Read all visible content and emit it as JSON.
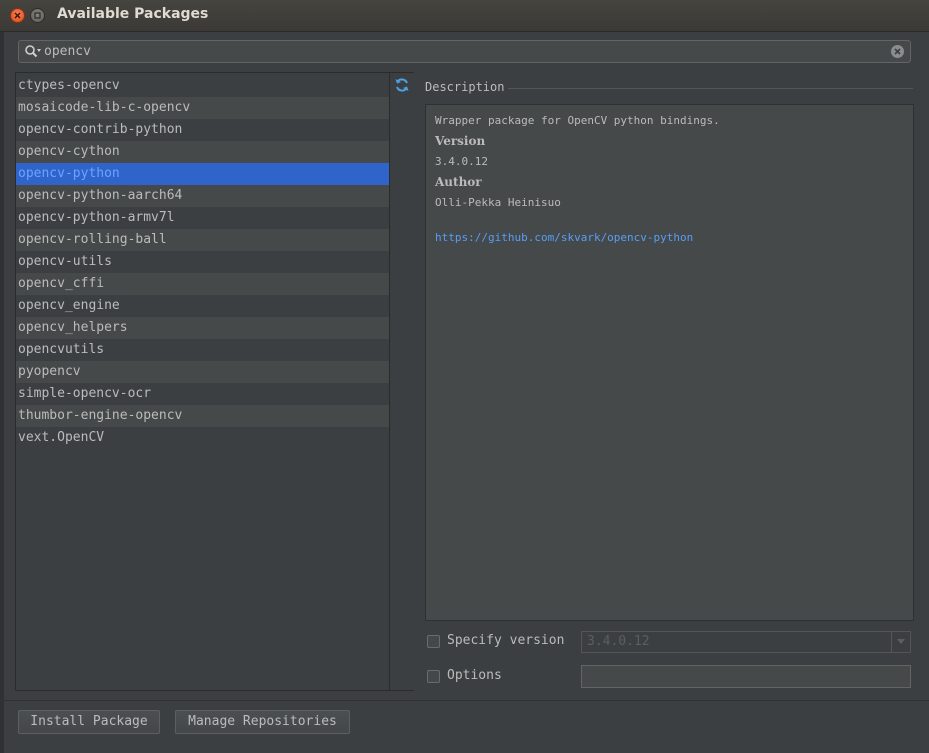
{
  "window": {
    "title": "Available Packages"
  },
  "search": {
    "value": "opencv",
    "placeholder": ""
  },
  "packages": {
    "items": [
      "ctypes-opencv",
      "mosaicode-lib-c-opencv",
      "opencv-contrib-python",
      "opencv-cython",
      "opencv-python",
      "opencv-python-aarch64",
      "opencv-python-armv7l",
      "opencv-rolling-ball",
      "opencv-utils",
      "opencv_cffi",
      "opencv_engine",
      "opencv_helpers",
      "opencvutils",
      "pyopencv",
      "simple-opencv-ocr",
      "thumbor-engine-opencv",
      "vext.OpenCV"
    ],
    "selected": "opencv-python"
  },
  "description": {
    "header": "Description",
    "summary": "Wrapper package for OpenCV python bindings.",
    "version_label": "Version",
    "version_value": "3.4.0.12",
    "author_label": "Author",
    "author_value": "Olli-Pekka Heinisuo",
    "url": "https://github.com/skvark/opencv-python"
  },
  "options": {
    "specify_version_label": "Specify version",
    "specify_version_checked": false,
    "version_selected": "3.4.0.12",
    "options_label": "Options",
    "options_checked": false,
    "options_value": ""
  },
  "buttons": {
    "install": "Install Package",
    "manage": "Manage Repositories"
  },
  "icons": {
    "close": "close-icon",
    "maximize": "maximize-icon",
    "search": "search-icon",
    "clear": "clear-search-icon",
    "reload": "reload-icon",
    "dropdown": "chevron-down-icon"
  },
  "colors": {
    "selection": "#2f65ca",
    "link": "#589df6",
    "close_button": "#dd4814"
  }
}
